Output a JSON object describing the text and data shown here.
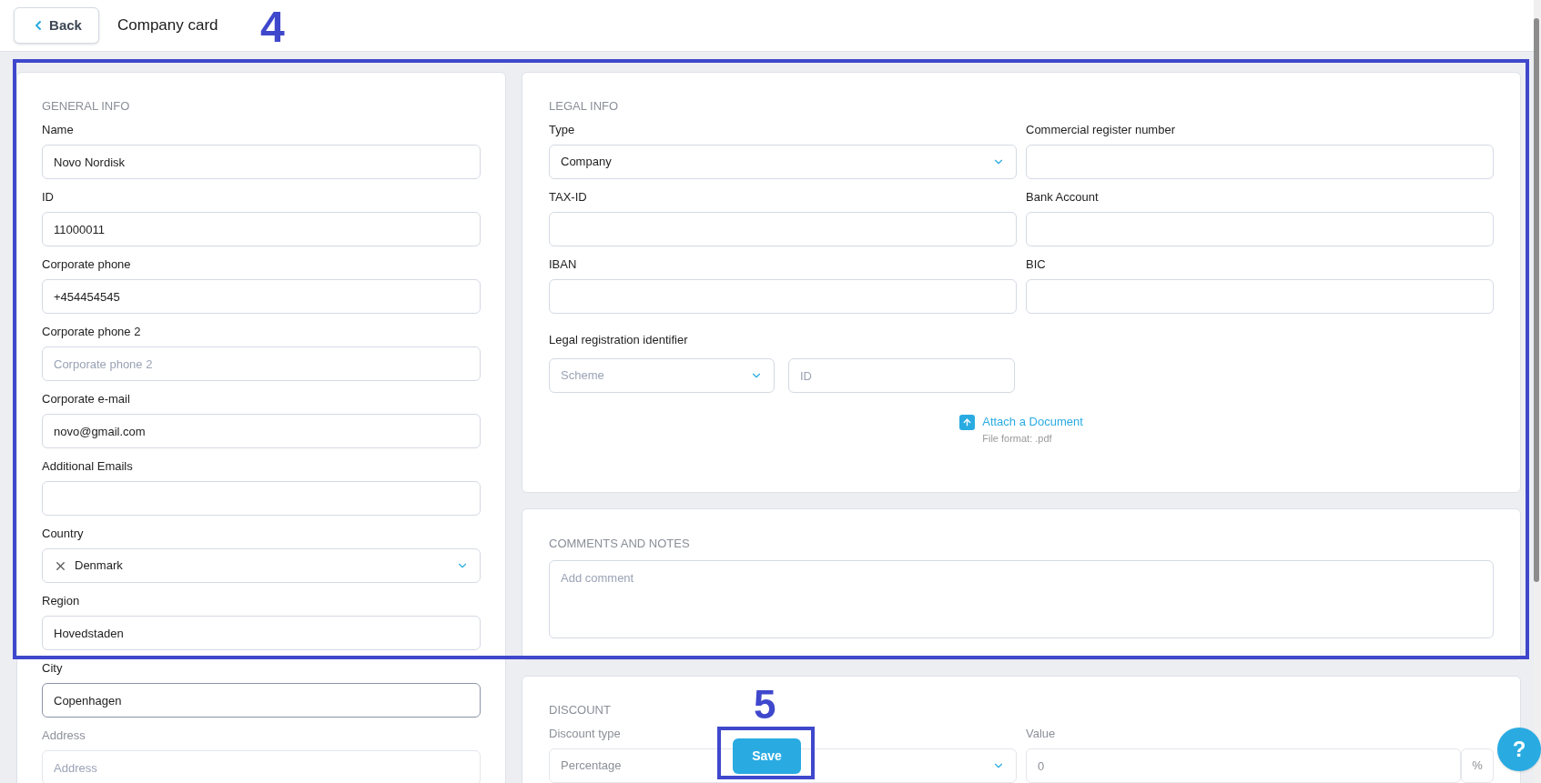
{
  "header": {
    "back_button": "Back",
    "title": "Company card"
  },
  "general_info": {
    "heading": "GENERAL INFO",
    "fields": [
      {
        "label": "Name",
        "kind": "text",
        "value": "Novo Nordisk",
        "focused": false
      },
      {
        "label": "ID",
        "kind": "text",
        "value": "11000011",
        "focused": false
      },
      {
        "label": "Corporate phone",
        "kind": "text",
        "value": "+454454545",
        "focused": false
      },
      {
        "label": "Corporate phone 2",
        "kind": "text",
        "placeholder": "Corporate phone 2",
        "focused": false
      },
      {
        "label": "Corporate e-mail",
        "kind": "text",
        "value": "novo@gmail.com",
        "focused": false
      },
      {
        "label": "Additional Emails",
        "kind": "text",
        "focused": false
      },
      {
        "label": "Country",
        "kind": "select",
        "value": "Denmark",
        "clearable": true,
        "focused": false
      },
      {
        "label": "Region",
        "kind": "text",
        "value": "Hovedstaden",
        "focused": false
      },
      {
        "label": "City",
        "kind": "text",
        "value": "Copenhagen",
        "focused": true
      },
      {
        "label": "Address",
        "kind": "text",
        "placeholder": "Address",
        "focused": false
      }
    ]
  },
  "legal_info": {
    "heading": "LEGAL INFO",
    "fields": [
      {
        "label": "Type",
        "kind": "select",
        "value": "Company",
        "clearable": false
      },
      {
        "label": "Commercial register number",
        "kind": "text"
      },
      {
        "label": "TAX-ID",
        "kind": "text"
      },
      {
        "label": "Bank Account",
        "kind": "text"
      },
      {
        "label": "IBAN",
        "kind": "text"
      },
      {
        "label": "BIC",
        "kind": "text"
      }
    ],
    "registration": {
      "label": "Legal registration identifier",
      "scheme_placeholder": "Scheme",
      "id_placeholder": "ID"
    },
    "attach": {
      "link": "Attach a Document",
      "note": "File format: .pdf"
    }
  },
  "comments": {
    "heading": "COMMENTS AND NOTES",
    "placeholder": "Add comment"
  },
  "discount": {
    "heading": "DISCOUNT",
    "type_label": "Discount type",
    "type_value": "Percentage",
    "value_label": "Value",
    "value": "0",
    "suffix": "%"
  },
  "save_button": "Save",
  "help_button": "?",
  "annotations": [
    {
      "label": "4"
    },
    {
      "label": "5"
    }
  ]
}
